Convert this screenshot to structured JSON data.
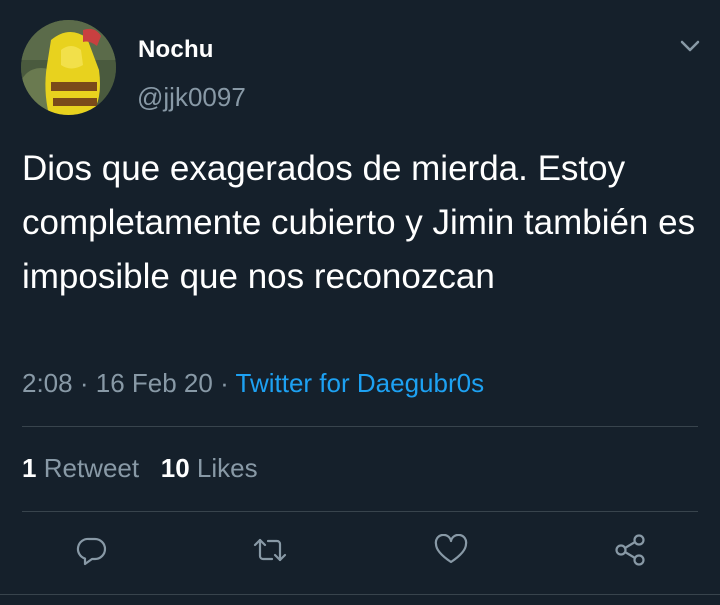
{
  "user": {
    "display_name": "Nochu",
    "handle": "@jjk0097"
  },
  "tweet": {
    "text": "Dios que exagerados de mierda. Estoy completamente cubierto y Jimin también es imposible que nos reconozcan",
    "time": "2:08",
    "separator": "·",
    "date": "16 Feb 20",
    "source": "Twitter for Daegubr0s"
  },
  "stats": {
    "retweets_count": "1",
    "retweets_label": "Retweet",
    "likes_count": "10",
    "likes_label": "Likes"
  },
  "icons": {
    "caret": "chevron-down-icon",
    "reply": "reply-icon",
    "retweet": "retweet-icon",
    "like": "heart-icon",
    "share": "share-icon"
  },
  "colors": {
    "background": "#15202b",
    "secondary_text": "#8899a6",
    "link": "#1da1f2",
    "divider": "#38444d"
  }
}
